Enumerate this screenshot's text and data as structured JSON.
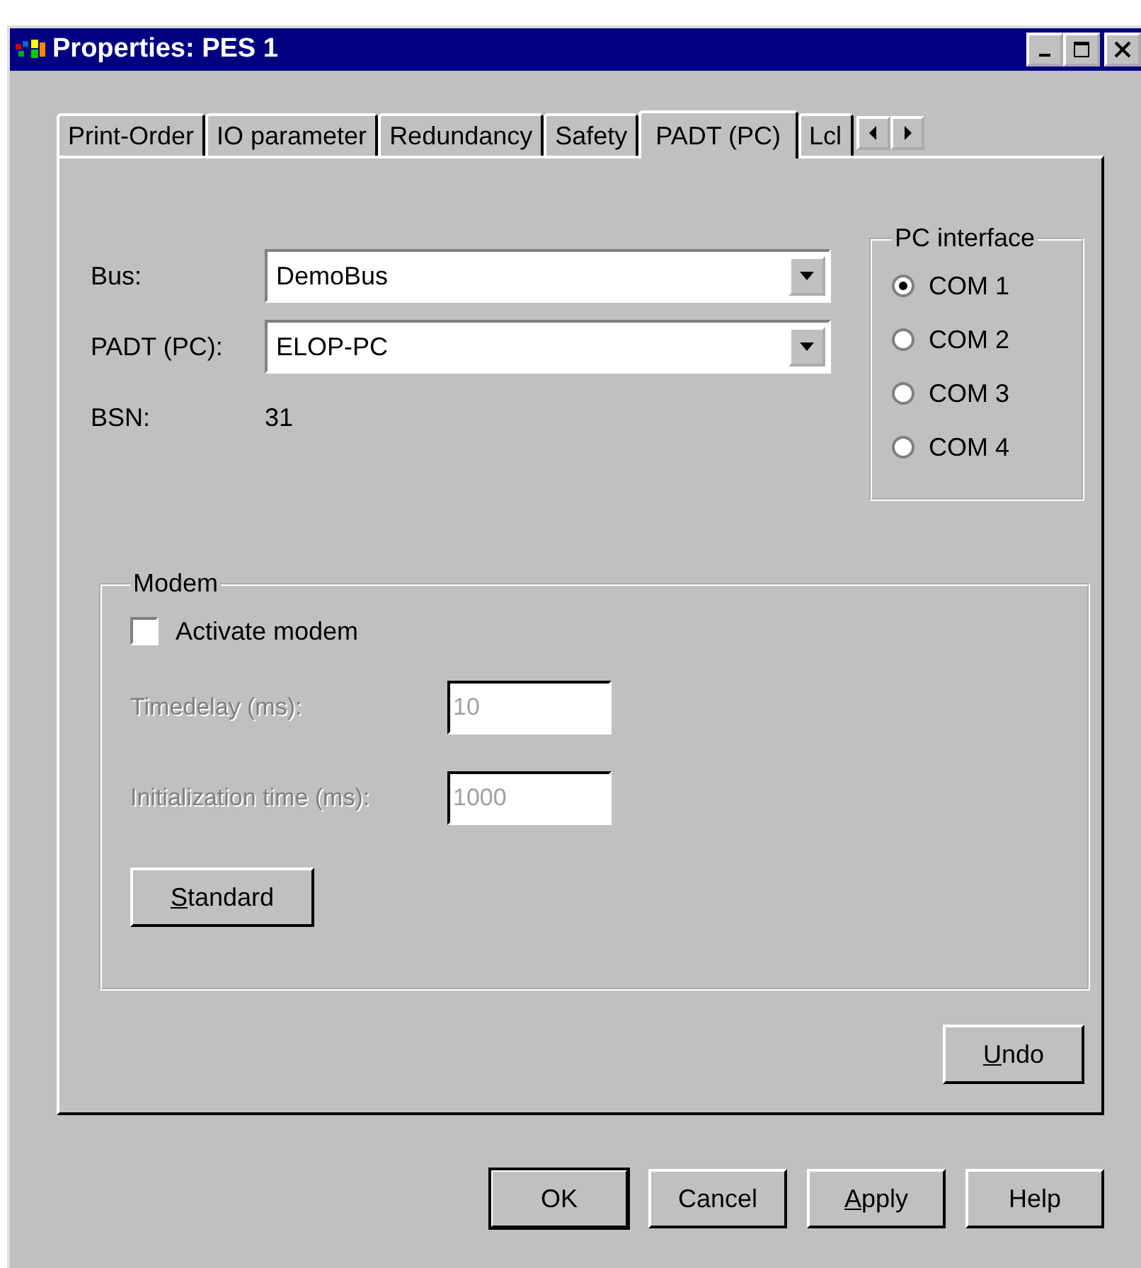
{
  "window": {
    "title": "Properties: PES 1"
  },
  "tabs": [
    {
      "label": "Print-Order",
      "selected": false
    },
    {
      "label": "IO parameter",
      "selected": false
    },
    {
      "label": "Redundancy",
      "selected": false
    },
    {
      "label": "Safety",
      "selected": false
    },
    {
      "label": "PADT (PC)",
      "selected": true
    },
    {
      "label": "Lcl",
      "selected": false
    }
  ],
  "fields": [
    {
      "label": "Bus:",
      "value": "DemoBus"
    },
    {
      "label": "PADT (PC):",
      "value": "ELOP-PC"
    }
  ],
  "bsn": {
    "label": "BSN:",
    "value": "31"
  },
  "pc_interface": {
    "title": "PC interface",
    "options": [
      {
        "label": "COM 1",
        "selected": true
      },
      {
        "label": "COM 2",
        "selected": false
      },
      {
        "label": "COM 3",
        "selected": false
      },
      {
        "label": "COM 4",
        "selected": false
      }
    ]
  },
  "modem": {
    "title": "Modem",
    "activate": {
      "label": "Activate modem",
      "checked": false
    },
    "inputs": [
      {
        "label": "Timedelay (ms):",
        "value": "10",
        "disabled": true
      },
      {
        "label": "Initialization time (ms):",
        "value": "1000",
        "disabled": true
      }
    ],
    "button": {
      "label": "Standard",
      "underline_first": true
    }
  },
  "undo_button": {
    "label": "Undo",
    "underline_first": true
  },
  "buttons": [
    {
      "label": "OK",
      "underline_first": false,
      "default": true
    },
    {
      "label": "Cancel",
      "underline_first": false,
      "default": false
    },
    {
      "label": "Apply",
      "underline_first": true,
      "default": false
    },
    {
      "label": "Help",
      "underline_first": false,
      "default": false
    }
  ]
}
